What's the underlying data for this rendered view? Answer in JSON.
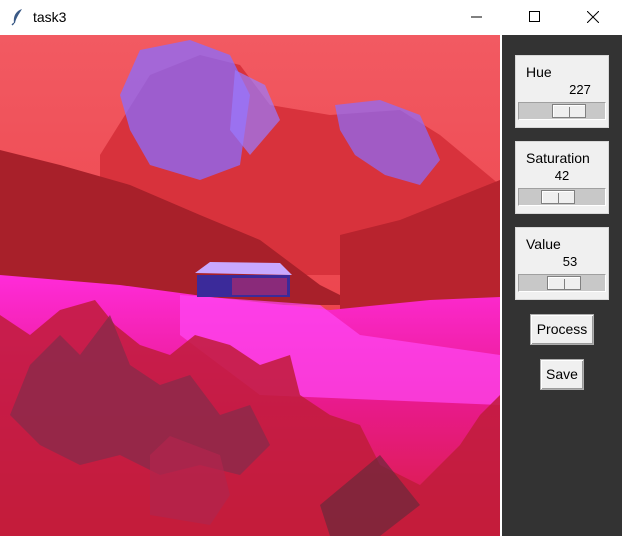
{
  "window": {
    "title": "task3"
  },
  "controls": {
    "hue": {
      "label": "Hue",
      "value": "227",
      "level": 0.63
    },
    "saturation": {
      "label": "Saturation",
      "value": "42",
      "level": 0.42
    },
    "value": {
      "label": "Value",
      "value": "53",
      "level": 0.53
    }
  },
  "buttons": {
    "process": "Process",
    "save": "Save"
  },
  "colors": {
    "panel": "#333333",
    "image_primary": "#e2222b",
    "image_magenta": "#ff00ff",
    "image_purple": "#8a6cff"
  }
}
